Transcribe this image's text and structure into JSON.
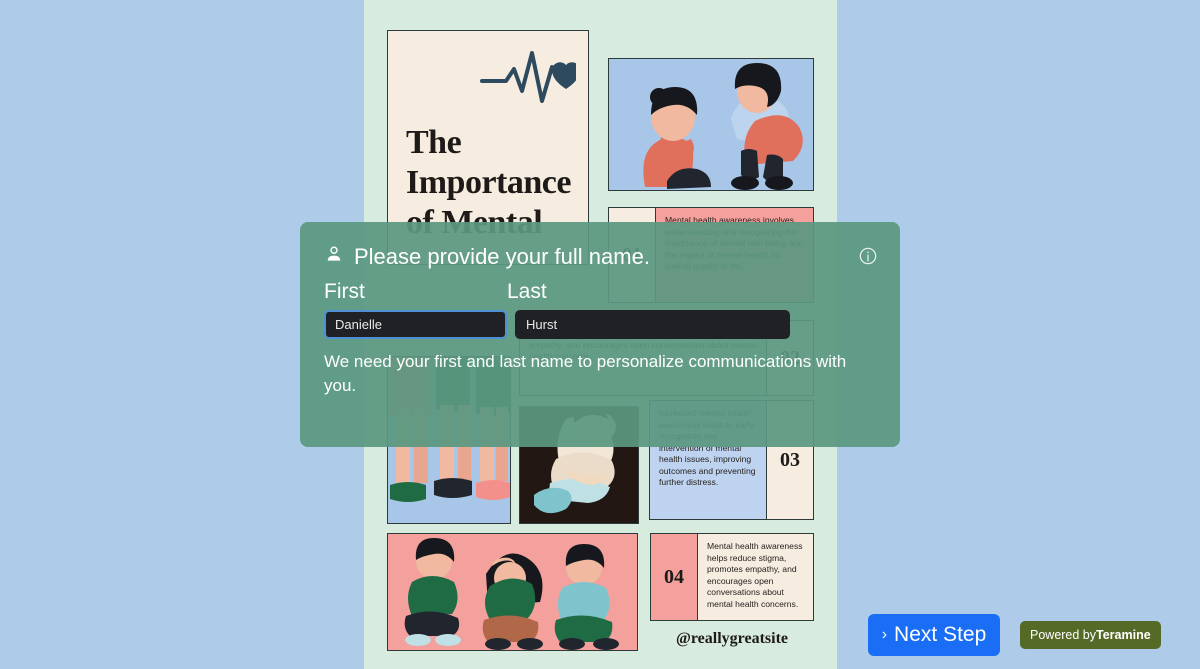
{
  "background_color": "#aeccea",
  "poster": {
    "background_color": "#d8ebdf",
    "title": "The Importance of Mental",
    "icon": "heartbeat-heart-icon",
    "handle": "@reallygreatsite",
    "facts": [
      {
        "number": "01",
        "text": "Mental health awareness involves understanding and recognizing the importance of mental well-being and the impact of mental health on overall quality of life.",
        "accent": "#f4a09c"
      },
      {
        "number": "02",
        "text": "Mental health awareness helps reduce stigma, promotes empathy, and encourages open conversations about mental health concerns.",
        "accent": "#d9e4c4"
      },
      {
        "number": "03",
        "text": "Increased mental health awareness leads to early recognition and intervention of mental health issues, improving outcomes and preventing further distress.",
        "accent": "#bdd3ef"
      },
      {
        "number": "04",
        "text": "Mental health awareness helps reduce stigma, promotes empathy, and encourages open conversations about mental health concerns.",
        "accent": "#f4a09c"
      }
    ],
    "photos": [
      {
        "name": "photo-comforting-child",
        "background": "#a8c7e8"
      },
      {
        "name": "photo-children-legs",
        "background": "#a8c7e8"
      },
      {
        "name": "photo-person-hugging-knees",
        "background": "#221712"
      },
      {
        "name": "photo-three-children-sitting",
        "background": "#f4a09c"
      }
    ]
  },
  "overlay": {
    "background_color": "#5a9880",
    "icon": "person-icon",
    "info_icon": "info-circle-icon",
    "heading": "Please provide your full name.",
    "first_label": "First",
    "last_label": "Last",
    "first_value": "Danielle",
    "first_placeholder": "First",
    "last_value": "Hurst",
    "last_placeholder": "Last",
    "help_text": "We need your first and last name to personalize communications with you.",
    "focus_color": "#4f8fd6"
  },
  "controls": {
    "next_step_label": "Next Step",
    "next_step_chevron": "›",
    "next_step_color": "#1a6ef5",
    "powered_prefix": "Powered by",
    "powered_brand": "Teramine",
    "powered_color": "#566a28"
  }
}
